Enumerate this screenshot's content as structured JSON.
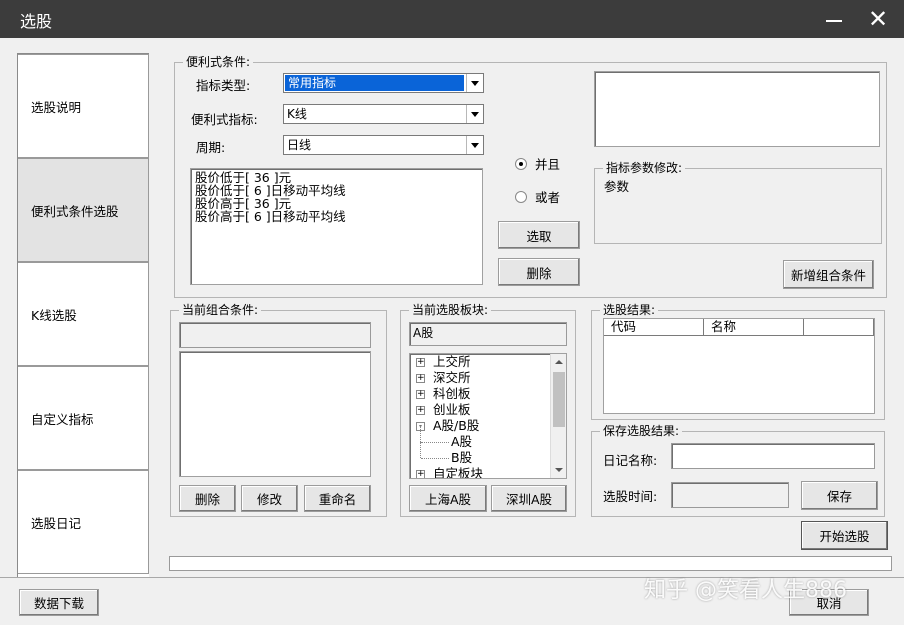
{
  "window": {
    "title": "选股"
  },
  "nav": {
    "items": [
      {
        "label": "选股说明"
      },
      {
        "label": "便利式条件选股"
      },
      {
        "label": "K线选股"
      },
      {
        "label": "自定义指标"
      },
      {
        "label": "选股日记"
      }
    ],
    "active_index": 1
  },
  "conditions": {
    "group_label": "便利式条件:",
    "indicator_type_label": "指标类型:",
    "indicator_type_value": "常用指标",
    "indicator_label": "便利式指标:",
    "indicator_value": "K线",
    "period_label": "周期:",
    "period_value": "日线",
    "lines": [
      "股价低于[ 36 ]元",
      "股价低于[ 6 ]日移动平均线",
      "股价高于[ 36 ]元",
      "股价高于[ 6 ]日移动平均线"
    ],
    "radio_and": "并且",
    "radio_or": "或者",
    "selected_radio": "并且",
    "select_button": "选取",
    "delete_button": "删除",
    "param_group_label": "指标参数修改:",
    "param_text": "参数",
    "add_combo_button": "新增组合条件"
  },
  "combo": {
    "group_label": "当前组合条件:",
    "delete_button": "删除",
    "modify_button": "修改",
    "rename_button": "重命名"
  },
  "blocks": {
    "group_label": "当前选股板块:",
    "current": "A股",
    "tree": [
      {
        "label": "上交所",
        "expander": "+"
      },
      {
        "label": "深交所",
        "expander": "+"
      },
      {
        "label": "科创板",
        "expander": "+"
      },
      {
        "label": "创业板",
        "expander": "+"
      },
      {
        "label": "A股/B股",
        "expander": "-"
      },
      {
        "label": "A股",
        "expander": ""
      },
      {
        "label": "B股",
        "expander": ""
      },
      {
        "label": "自定板块",
        "expander": "+"
      }
    ],
    "sh_button": "上海A股",
    "sz_button": "深圳A股"
  },
  "results": {
    "group_label": "选股结果:",
    "columns": [
      "代码",
      "名称",
      ""
    ]
  },
  "save": {
    "group_label": "保存选股结果:",
    "name_label": "日记名称:",
    "name_value": "",
    "time_label": "选股时间:",
    "time_value": "",
    "save_button": "保存"
  },
  "actions": {
    "start_button": "开始选股",
    "cancel_button": "取消",
    "download_button": "数据下载"
  },
  "watermark": "知乎 @笑看人生886"
}
